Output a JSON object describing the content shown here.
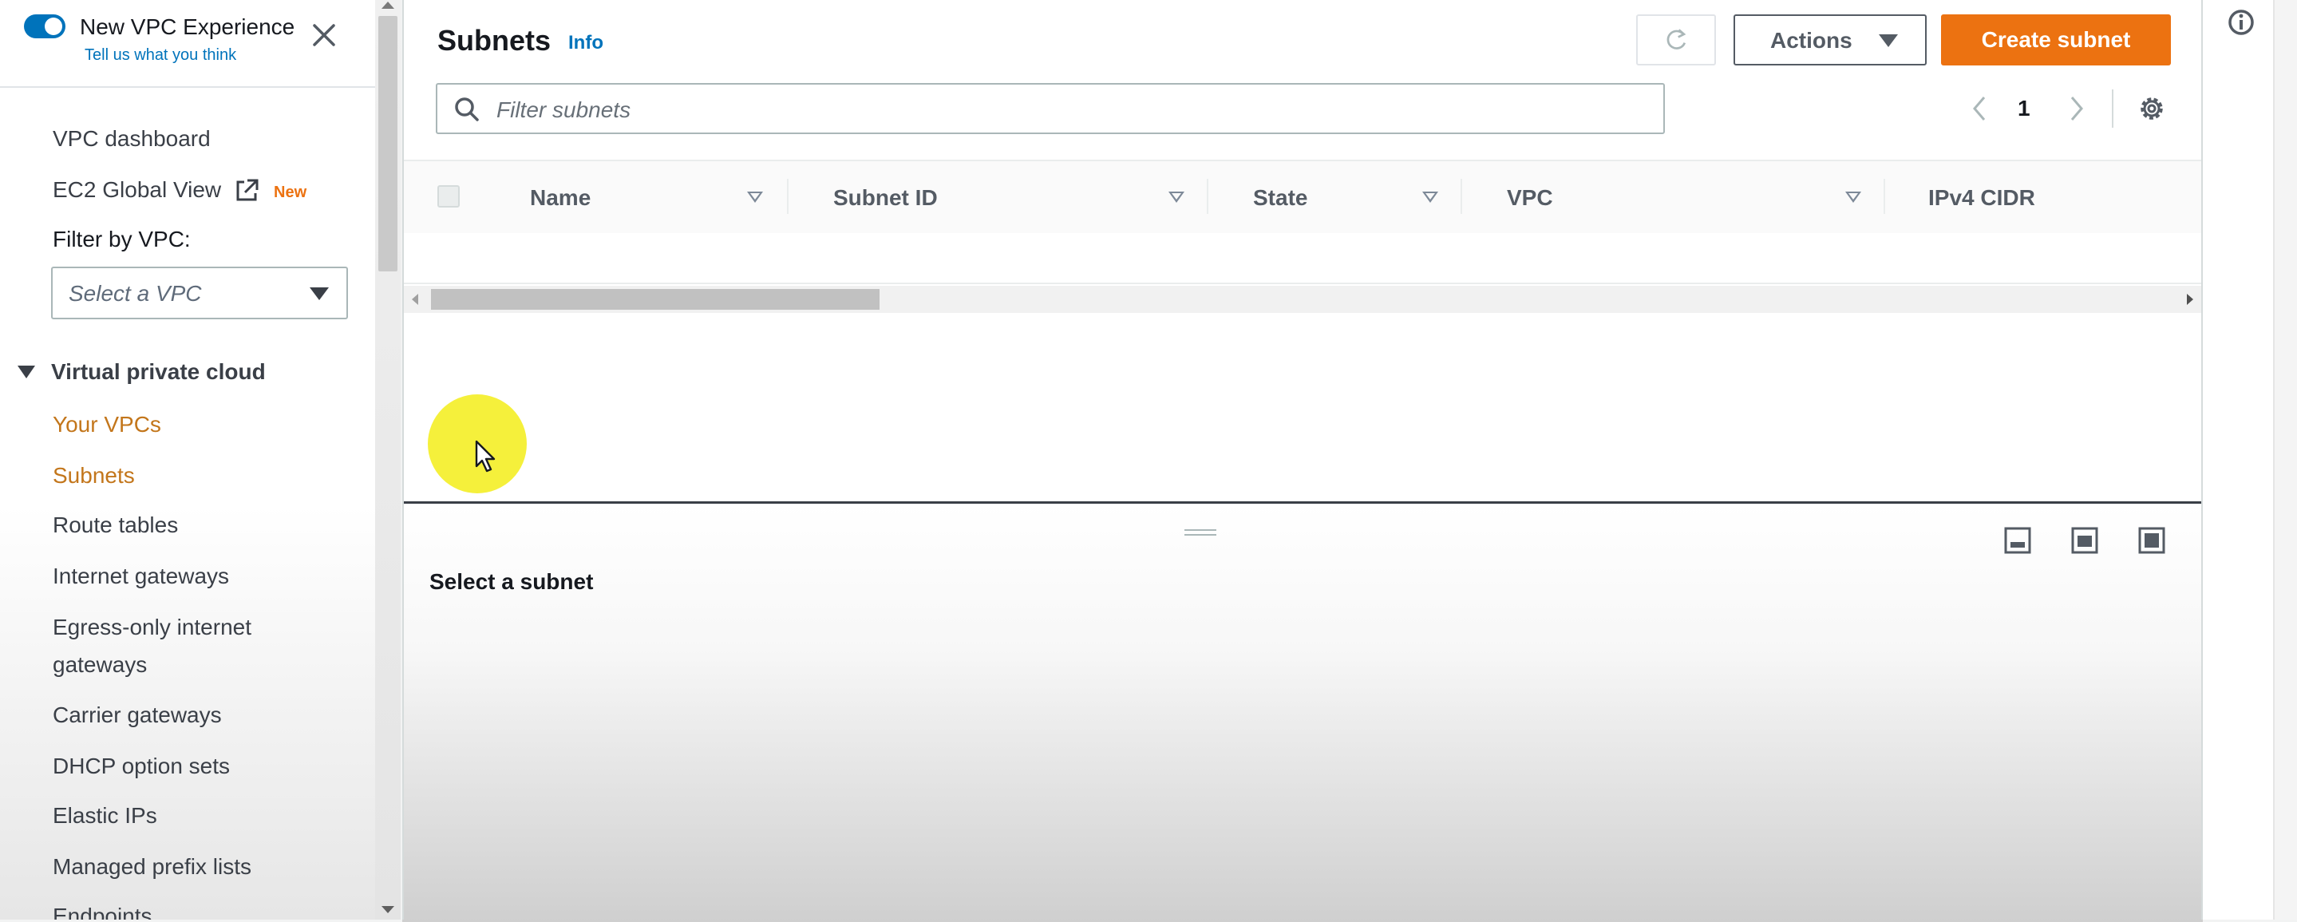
{
  "sidebar": {
    "experience_title": "New VPC Experience",
    "experience_feedback": "Tell us what you think",
    "top_links": [
      {
        "label": "VPC dashboard"
      },
      {
        "label": "EC2 Global View",
        "badge": "New"
      }
    ],
    "filter_label": "Filter by VPC:",
    "filter_placeholder": "Select a VPC",
    "section_title": "Virtual private cloud",
    "items": [
      {
        "label": "Your VPCs",
        "active": true
      },
      {
        "label": "Subnets",
        "active": true
      },
      {
        "label": "Route tables"
      },
      {
        "label": "Internet gateways"
      },
      {
        "label": "Egress-only internet gateways"
      },
      {
        "label": "Carrier gateways"
      },
      {
        "label": "DHCP option sets"
      },
      {
        "label": "Elastic IPs"
      },
      {
        "label": "Managed prefix lists"
      },
      {
        "label": "Endpoints"
      }
    ]
  },
  "header": {
    "title": "Subnets",
    "info_link": "Info",
    "actions_label": "Actions",
    "create_label": "Create subnet"
  },
  "filter": {
    "placeholder": "Filter subnets"
  },
  "pagination": {
    "current_page": "1"
  },
  "table": {
    "columns": [
      "Name",
      "Subnet ID",
      "State",
      "VPC",
      "IPv4 CIDR"
    ]
  },
  "split_panel": {
    "empty_message": "Select a subnet"
  },
  "colors": {
    "accent_orange": "#ec7211",
    "link_blue": "#0073bb",
    "active_nav": "#c3761b"
  },
  "icons": [
    "close-icon",
    "external-link-icon",
    "refresh-icon",
    "search-icon",
    "settings-icon",
    "info-icon",
    "chevron-left-icon",
    "chevron-right-icon"
  ]
}
